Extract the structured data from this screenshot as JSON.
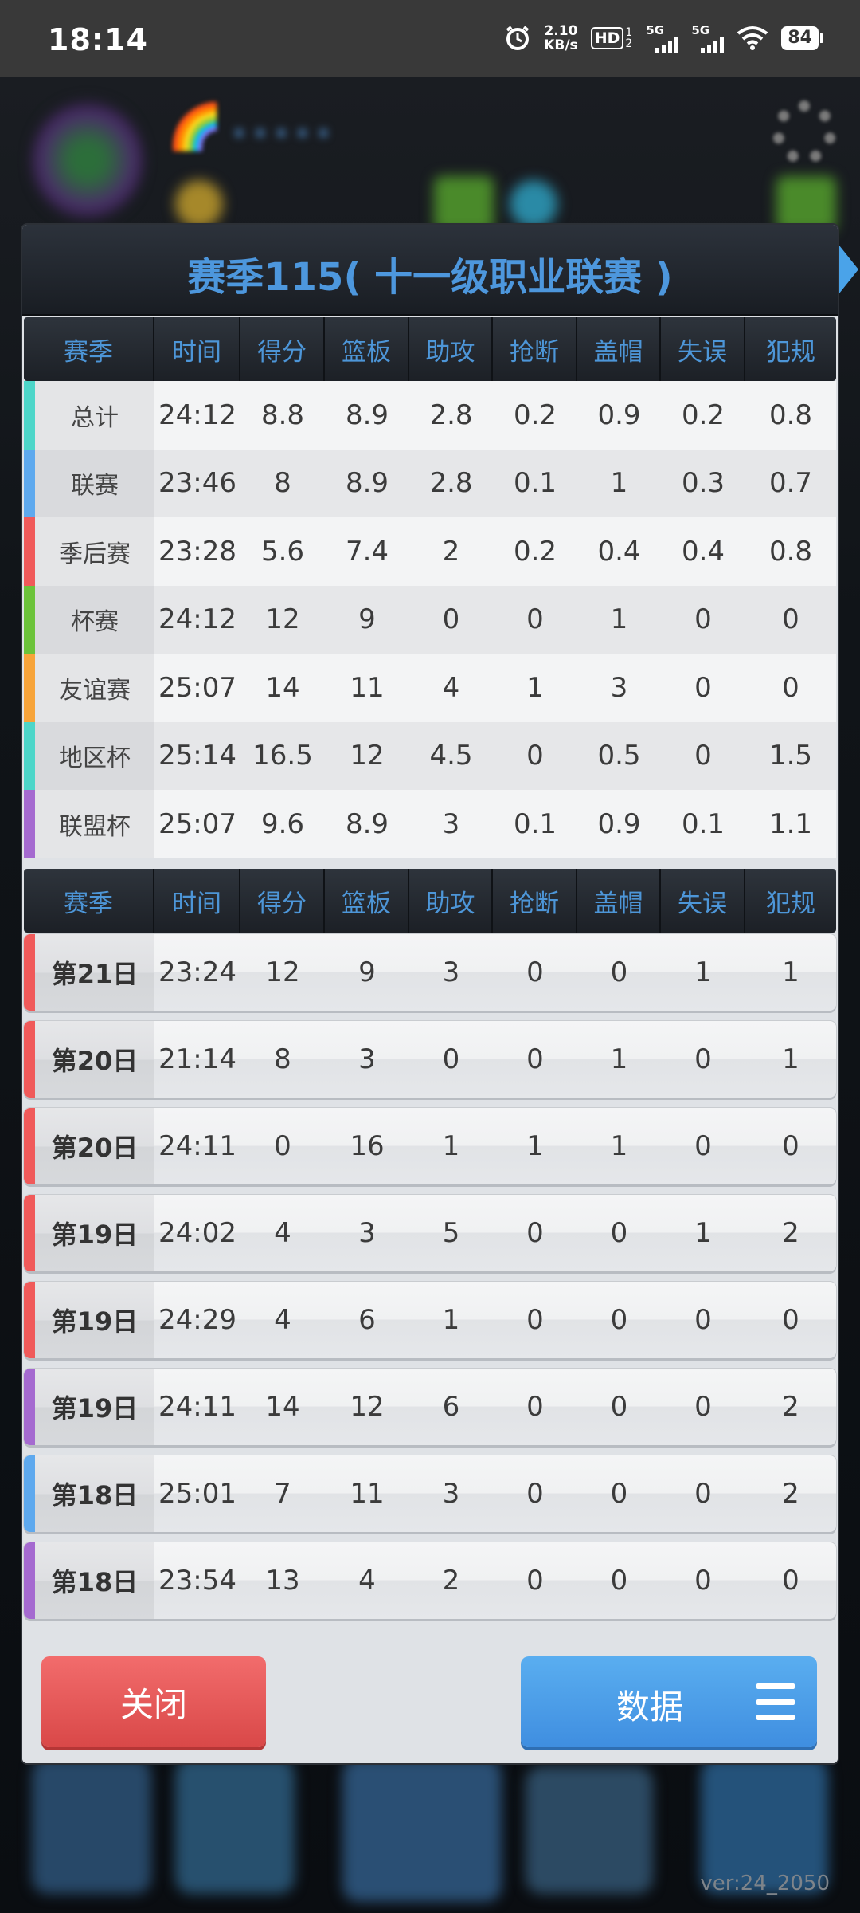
{
  "status_bar": {
    "time": "18:14",
    "net_speed_value": "2.10",
    "net_speed_unit": "KB/s",
    "hd_label": "HD",
    "hd_sub": "1 2",
    "sim1": "5G",
    "sim2": "5G",
    "battery": "84"
  },
  "background": {
    "version": "ver:24_2050"
  },
  "dialog": {
    "title": "赛季115( 十一级职业联赛 )",
    "columns": [
      "赛季",
      "时间",
      "得分",
      "篮板",
      "助攻",
      "抢断",
      "盖帽",
      "失误",
      "犯规"
    ],
    "summary_rows": [
      {
        "name": "总计",
        "color": "#4dd6c9",
        "cells": [
          "24:12",
          "8.8",
          "8.9",
          "2.8",
          "0.2",
          "0.9",
          "0.2",
          "0.8"
        ]
      },
      {
        "name": "联赛",
        "color": "#5ea9ee",
        "cells": [
          "23:46",
          "8",
          "8.9",
          "2.8",
          "0.1",
          "1",
          "0.3",
          "0.7"
        ]
      },
      {
        "name": "季后赛",
        "color": "#f05a5a",
        "cells": [
          "23:28",
          "5.6",
          "7.4",
          "2",
          "0.2",
          "0.4",
          "0.4",
          "0.8"
        ]
      },
      {
        "name": "杯赛",
        "color": "#6cc33a",
        "cells": [
          "24:12",
          "12",
          "9",
          "0",
          "0",
          "1",
          "0",
          "0"
        ]
      },
      {
        "name": "友谊赛",
        "color": "#f7a43a",
        "cells": [
          "25:07",
          "14",
          "11",
          "4",
          "1",
          "3",
          "0",
          "0"
        ]
      },
      {
        "name": "地区杯",
        "color": "#4dd6c9",
        "cells": [
          "25:14",
          "16.5",
          "12",
          "4.5",
          "0",
          "0.5",
          "0",
          "1.5"
        ]
      },
      {
        "name": "联盟杯",
        "color": "#a56ad0",
        "cells": [
          "25:07",
          "9.6",
          "8.9",
          "3",
          "0.1",
          "0.9",
          "0.1",
          "1.1"
        ]
      }
    ],
    "game_rows": [
      {
        "name": "第21日",
        "color": "#f05a5a",
        "cells": [
          "23:24",
          "12",
          "9",
          "3",
          "0",
          "0",
          "1",
          "1"
        ]
      },
      {
        "name": "第20日",
        "color": "#f05a5a",
        "cells": [
          "21:14",
          "8",
          "3",
          "0",
          "0",
          "1",
          "0",
          "1"
        ]
      },
      {
        "name": "第20日",
        "color": "#f05a5a",
        "cells": [
          "24:11",
          "0",
          "16",
          "1",
          "1",
          "1",
          "0",
          "0"
        ]
      },
      {
        "name": "第19日",
        "color": "#f05a5a",
        "cells": [
          "24:02",
          "4",
          "3",
          "5",
          "0",
          "0",
          "1",
          "2"
        ]
      },
      {
        "name": "第19日",
        "color": "#f05a5a",
        "cells": [
          "24:29",
          "4",
          "6",
          "1",
          "0",
          "0",
          "0",
          "0"
        ]
      },
      {
        "name": "第19日",
        "color": "#a56ad0",
        "cells": [
          "24:11",
          "14",
          "12",
          "6",
          "0",
          "0",
          "0",
          "2"
        ]
      },
      {
        "name": "第18日",
        "color": "#5ea9ee",
        "cells": [
          "25:01",
          "7",
          "11",
          "3",
          "0",
          "0",
          "0",
          "2"
        ]
      },
      {
        "name": "第18日",
        "color": "#a56ad0",
        "cells": [
          "23:54",
          "13",
          "4",
          "2",
          "0",
          "0",
          "0",
          "0"
        ]
      }
    ],
    "buttons": {
      "close": "关闭",
      "data": "数据"
    }
  }
}
